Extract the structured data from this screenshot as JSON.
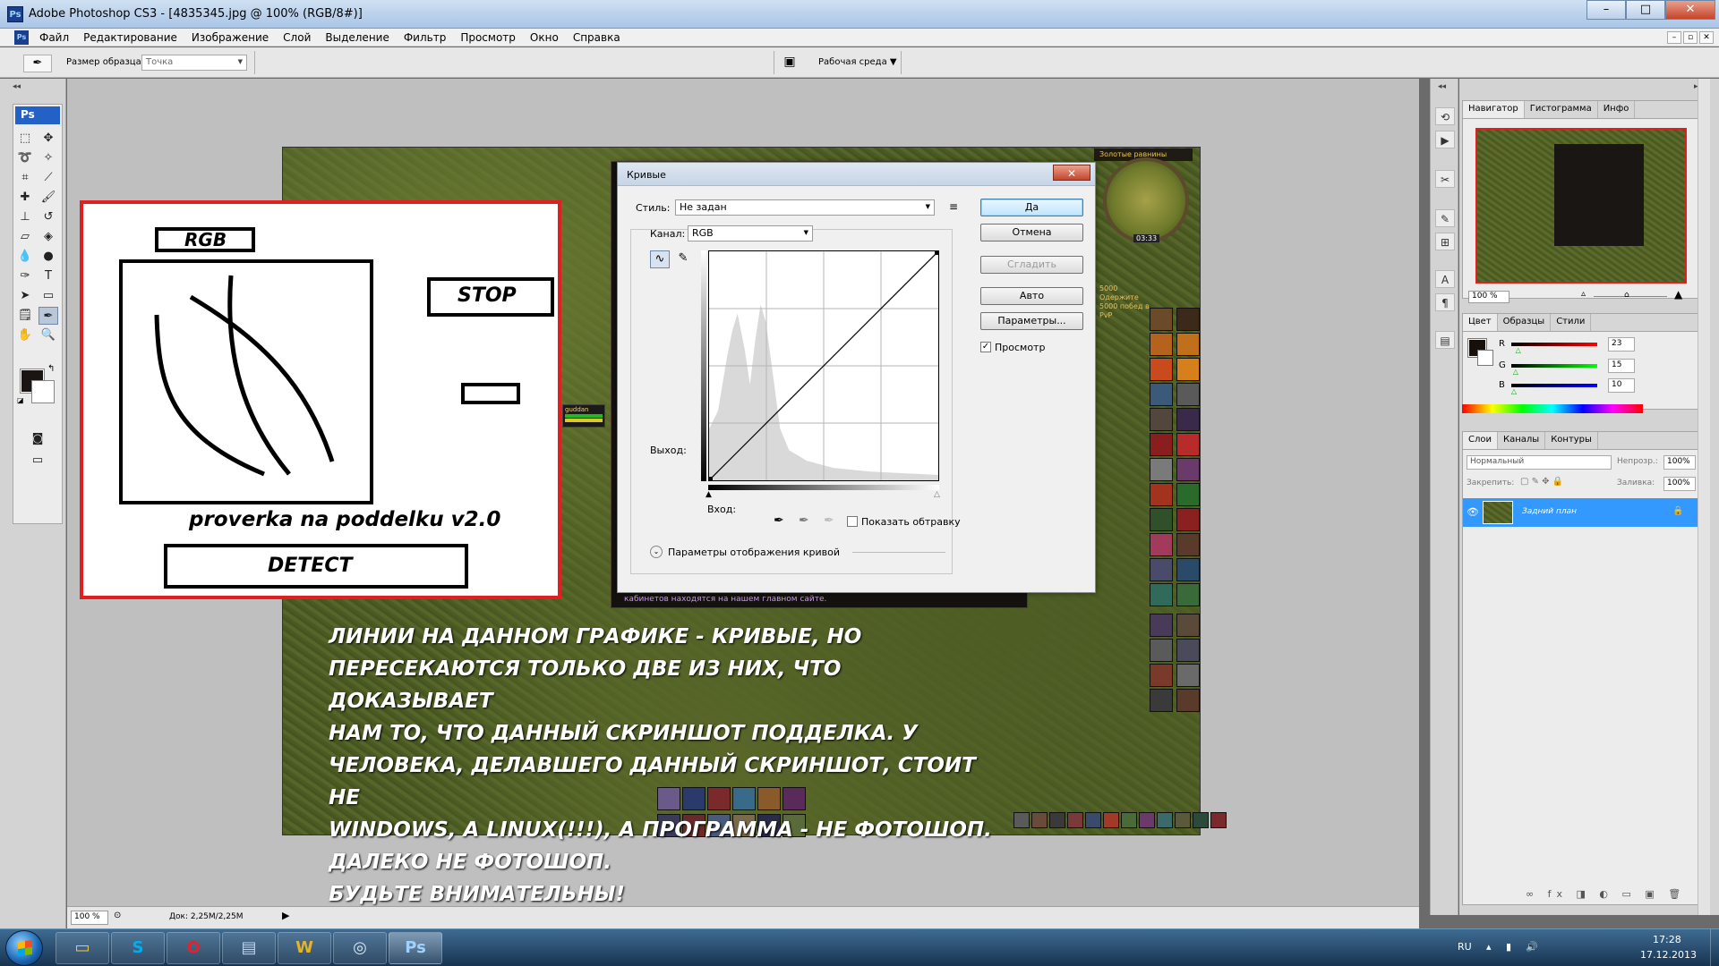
{
  "window": {
    "title": "Adobe Photoshop CS3 - [4835345.jpg @ 100% (RGB/8#)]",
    "controls": {
      "minimize": "–",
      "maximize": "□",
      "close": "✕"
    }
  },
  "menu": [
    "Файл",
    "Редактирование",
    "Изображение",
    "Слой",
    "Выделение",
    "Фильтр",
    "Просмотр",
    "Окно",
    "Справка"
  ],
  "mdi_controls": [
    "–",
    "▫",
    "✕"
  ],
  "options": {
    "sample_label": "Размер образца:",
    "sample_value": "Точка",
    "workspace": "Рабочая среда ▼"
  },
  "toolbox": {
    "logo": "Ps"
  },
  "status": {
    "zoom": "100 %",
    "doc": "Док: 2,25M/2,25M"
  },
  "annotation": {
    "rgb": "RGB",
    "stop": "STOP",
    "subtitle": "proverka na poddelku v2.0",
    "detect": "DETECT"
  },
  "overlay_text": "ЛИНИИ НА ДАННОМ ГРАФИКЕ - КРИВЫЕ, НО\nПЕРЕСЕКАЮТСЯ ТОЛЬКО ДВЕ ИЗ НИХ, ЧТО ДОКАЗЫВАЕТ\nНАМ ТО, ЧТО ДАННЫЙ СКРИНШОТ ПОДДЕЛКА. У\nЧЕЛОВЕКА, ДЕЛАВШЕГО ДАННЫЙ СКРИНШОТ, СТОИТ НЕ\nWINDOWS, А LINUX(!!!), А ПРОГРАММА - НЕ ФОТОШОП.\nДАЛЕКО НЕ ФОТОШОП.\nБУДЬТЕ ВНИМАТЕЛЬНЫ!",
  "game": {
    "minimap_title": "Золотые равнины",
    "minimap_time": "03:33",
    "chat_bottom": "кабинетов находятся на нашем главном сайте.",
    "quest_text": "5000 Одержите 5000 побед в PvP",
    "target_name": "guddan"
  },
  "curves": {
    "title": "Кривые",
    "close": "✕",
    "style_label": "Стиль:",
    "style_value": "Не задан",
    "channel_label": "Канал:",
    "channel_value": "RGB",
    "output_label": "Выход:",
    "input_label": "Вход:",
    "show_clipping": "Показать обтравку",
    "display_options": "Параметры отображения кривой",
    "buttons": {
      "ok": "Да",
      "cancel": "Отмена",
      "smooth": "Сгладить",
      "auto": "Авто",
      "options": "Параметры..."
    },
    "preview": "Просмотр",
    "preview_checked": "✓"
  },
  "navigator": {
    "tabs": [
      "Навигатор",
      "Гистограмма",
      "Инфо"
    ],
    "zoom": "100 %"
  },
  "color_panel": {
    "tabs": [
      "Цвет",
      "Образцы",
      "Стили"
    ],
    "r_label": "R",
    "g_label": "G",
    "b_label": "B",
    "r_value": "23",
    "g_value": "15",
    "b_value": "10",
    "r_level": 0.09,
    "g_level": 0.06,
    "b_level": 0.04
  },
  "layers_panel": {
    "tabs": [
      "Слои",
      "Каналы",
      "Контуры"
    ],
    "blend_mode": "Нормальный",
    "opacity_label": "Непрозр.:",
    "opacity_value": "100%",
    "lock_label": "Закрепить:",
    "fill_label": "Заливка:",
    "fill_value": "100%",
    "layer_name": "Задний план"
  },
  "taskbar": {
    "lang": "RU",
    "time": "17:28",
    "date": "17.12.2013"
  },
  "colors": {
    "annotation_border": "#e02020",
    "curves_default_button": "#bee6fd",
    "selected_layer": "#3399ff"
  }
}
